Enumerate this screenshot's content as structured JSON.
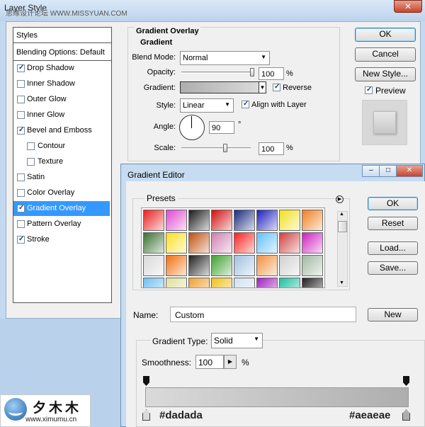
{
  "layer_style": {
    "title": "Layer Style",
    "watermark": "思缘设计论坛 WWW.MISSYUAN.COM",
    "close_glyph": "✕",
    "styles_header": "Styles",
    "blending_options": "Blending Options: Default",
    "items": [
      {
        "label": "Drop Shadow",
        "checked": true,
        "sub": false,
        "selected": false
      },
      {
        "label": "Inner Shadow",
        "checked": false,
        "sub": false,
        "selected": false
      },
      {
        "label": "Outer Glow",
        "checked": false,
        "sub": false,
        "selected": false
      },
      {
        "label": "Inner Glow",
        "checked": false,
        "sub": false,
        "selected": false
      },
      {
        "label": "Bevel and Emboss",
        "checked": true,
        "sub": false,
        "selected": false
      },
      {
        "label": "Contour",
        "checked": false,
        "sub": true,
        "selected": false
      },
      {
        "label": "Texture",
        "checked": false,
        "sub": true,
        "selected": false
      },
      {
        "label": "Satin",
        "checked": false,
        "sub": false,
        "selected": false
      },
      {
        "label": "Color Overlay",
        "checked": false,
        "sub": false,
        "selected": false
      },
      {
        "label": "Gradient Overlay",
        "checked": true,
        "sub": false,
        "selected": true
      },
      {
        "label": "Pattern Overlay",
        "checked": false,
        "sub": false,
        "selected": false
      },
      {
        "label": "Stroke",
        "checked": true,
        "sub": false,
        "selected": false
      }
    ],
    "gradient_overlay": {
      "group_title": "Gradient Overlay",
      "subgroup_title": "Gradient",
      "blend_mode_label": "Blend Mode:",
      "blend_mode_value": "Normal",
      "opacity_label": "Opacity:",
      "opacity_value": "100",
      "opacity_unit": "%",
      "opacity_level": 1.0,
      "gradient_label": "Gradient:",
      "reverse_label": "Reverse",
      "reverse_checked": true,
      "style_label": "Style:",
      "style_value": "Linear",
      "align_label": "Align with Layer",
      "align_checked": true,
      "angle_label": "Angle:",
      "angle_value": "90",
      "angle_unit": "°",
      "scale_label": "Scale:",
      "scale_value": "100",
      "scale_unit": "%",
      "scale_level": 0.5
    },
    "buttons": {
      "ok": "OK",
      "cancel": "Cancel",
      "new_style": "New Style...",
      "preview_label": "Preview",
      "preview_checked": true
    }
  },
  "gradient_editor": {
    "title": "Gradient Editor",
    "presets_label": "Presets",
    "buttons": {
      "ok": "OK",
      "reset": "Reset",
      "load": "Load...",
      "save": "Save...",
      "new": "New"
    },
    "name_label": "Name:",
    "name_value": "Custom",
    "gradient_type_label": "Gradient Type:",
    "gradient_type_value": "Solid",
    "smoothness_label": "Smoothness:",
    "smoothness_value": "100",
    "smoothness_unit": "%",
    "left_color": "#dadada",
    "right_color": "#aeaeae",
    "preset_swatches": [
      [
        "#e82020",
        "#e04ad0",
        "#1a1a1a",
        "#d01010",
        "#1a2a80",
        "#2020c0",
        "#f0e020",
        "#f08020"
      ],
      [
        "#3a7030",
        "#ffe020",
        "#c05010",
        "#d080b0",
        "#ff2020",
        "#60c0ff",
        "#d04040",
        "#d020c0"
      ],
      [
        "#d8d8d8",
        "#f07010",
        "#202020",
        "#40a030",
        "#a0c0e0",
        "#f09040",
        "#d0d0d0",
        "#a0b8a0"
      ],
      [
        "#70c0f0",
        "#e0e0a0",
        "#f0a030",
        "#f0c020",
        "#d0e0f0",
        "#a020c0",
        "#20c0a0",
        "#202020"
      ]
    ]
  },
  "logo": {
    "text": "夕木木",
    "url": "www.ximumu.cn"
  }
}
